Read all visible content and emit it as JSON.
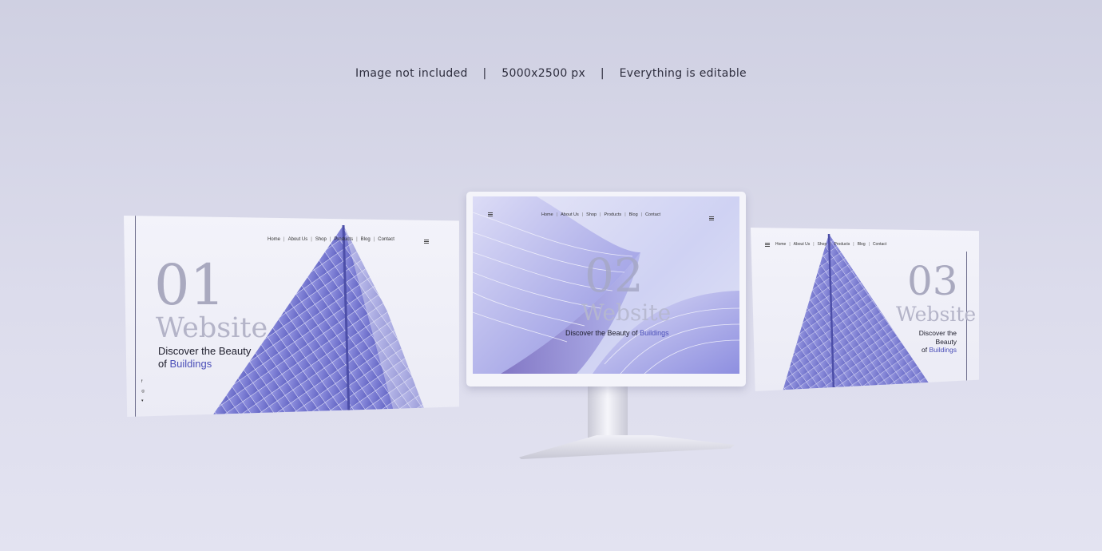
{
  "caption": {
    "part1": "Image not included",
    "part2": "5000x2500 px",
    "part3": "Everything is editable",
    "separator": "|"
  },
  "nav": {
    "items": [
      "Home",
      "About Us",
      "Shop",
      "Products",
      "Blog",
      "Contact"
    ],
    "separator": "|"
  },
  "screens": [
    {
      "number": "01",
      "word": "Website",
      "tagline_line1": "Discover the Beauty",
      "tagline_prefix": "of",
      "tagline_highlight": "Buildings"
    },
    {
      "number": "02",
      "word": "Website",
      "tagline_line1": "Discover the Beauty of",
      "tagline_highlight": "Buildings"
    },
    {
      "number": "03",
      "word": "Website",
      "tagline_line1": "Discover the Beauty",
      "tagline_prefix": "of",
      "tagline_highlight": "Buildings"
    }
  ],
  "social_icons": [
    "facebook-icon",
    "instagram-icon",
    "twitter-icon"
  ],
  "colors": {
    "background": "#d6d7e8",
    "accent": "#4b4fb8",
    "building_glass": "#7e7fd6",
    "text_dark": "#1c1c2a"
  }
}
